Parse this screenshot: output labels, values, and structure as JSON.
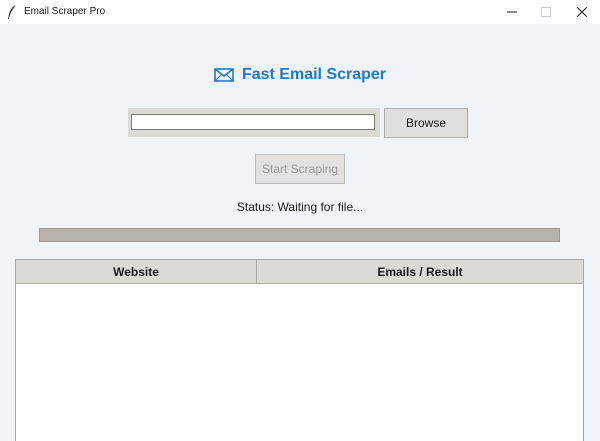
{
  "window": {
    "title": "Email Scraper Pro",
    "controls": [
      "minimize",
      "maximize",
      "close"
    ]
  },
  "header": {
    "icon": "envelope-icon",
    "title": "Fast Email Scraper",
    "accent_color": "#1d7ac9"
  },
  "file_picker": {
    "path_value": "",
    "browse_label": "Browse"
  },
  "actions": {
    "start_label": "Start Scraping",
    "start_enabled": false
  },
  "status": {
    "text": "Status: Waiting for file..."
  },
  "progress": {
    "value": 0
  },
  "table": {
    "columns": [
      "Website",
      "Emails / Result"
    ],
    "rows": []
  }
}
